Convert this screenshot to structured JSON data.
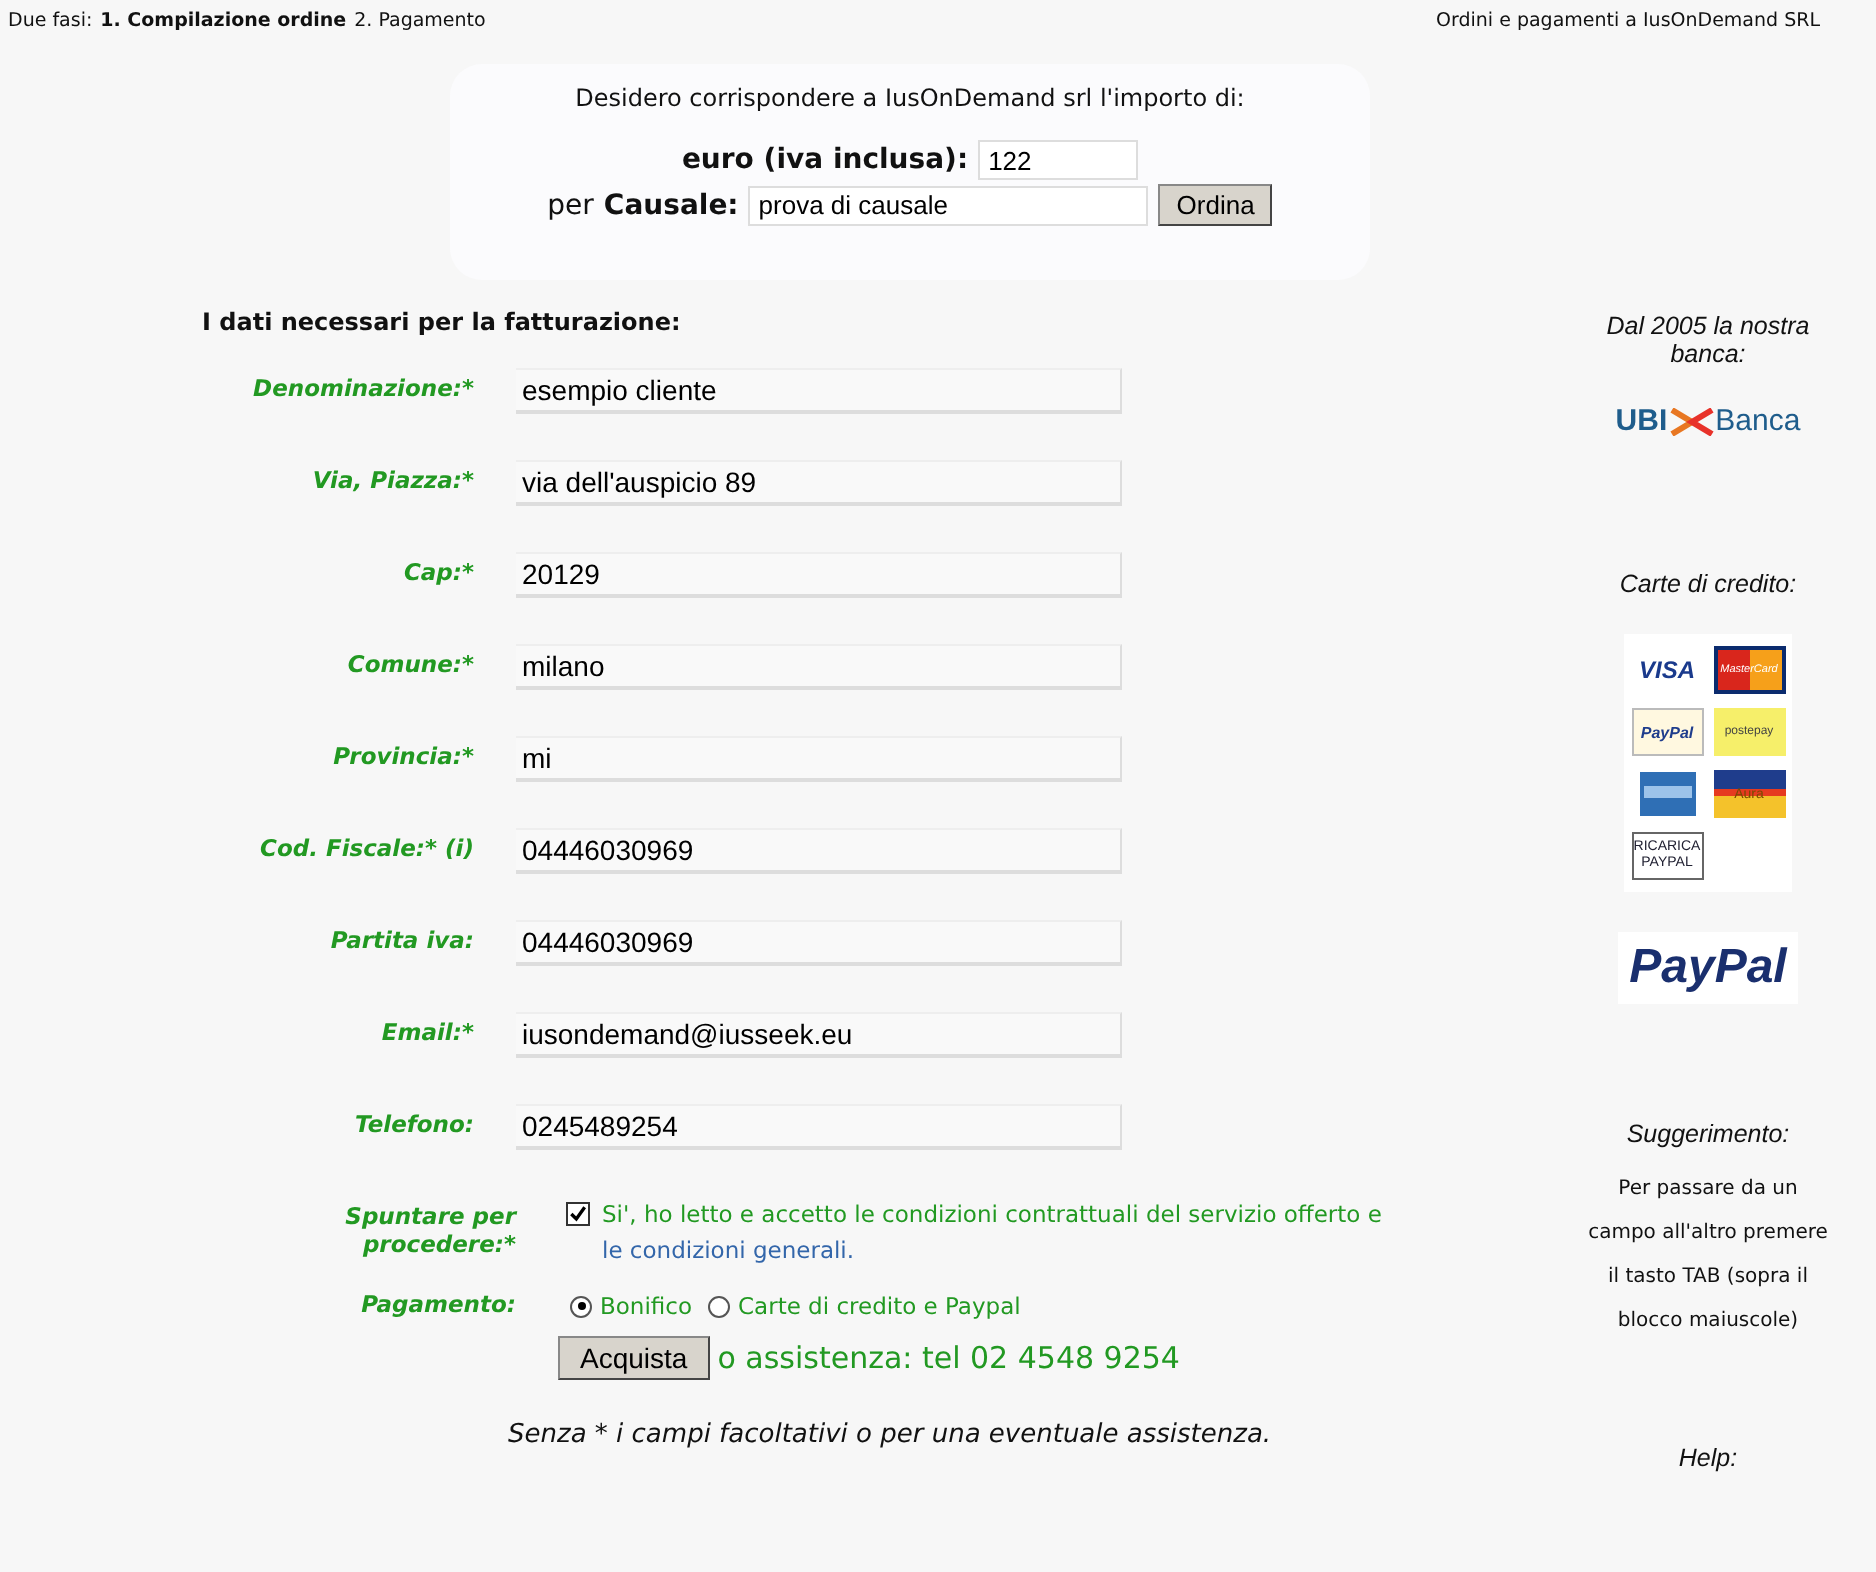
{
  "header": {
    "steps_label": "Due fasi:",
    "steps": [
      {
        "label": "1. Compilazione ordine",
        "selected": true
      },
      {
        "label": "2. Pagamento",
        "selected": false
      }
    ],
    "right": "Ordini e pagamenti a IusOnDemand SRL"
  },
  "order": {
    "intro": "Desidero corrispondere a IusOnDemand srl l'importo di:",
    "amount_label": "euro (iva inclusa):",
    "amount": "122",
    "reason_prefix": "per",
    "reason_label": "Causale:",
    "reason": "prova di causale",
    "button": "Ordina"
  },
  "billing": {
    "title": "I dati necessari per la fatturazione:",
    "fields": [
      {
        "label": "Denominazione:*",
        "value": "esempio cliente"
      },
      {
        "label": "Via, Piazza:*",
        "value": "via dell'auspicio 89"
      },
      {
        "label": "Cap:*",
        "value": "20129"
      },
      {
        "label": "Comune:*",
        "value": "milano"
      },
      {
        "label": "Provincia:*",
        "value": "mi"
      },
      {
        "label": "Cod. Fiscale:* (i)",
        "value": "04446030969"
      },
      {
        "label": "Partita iva:",
        "value": "04446030969"
      },
      {
        "label": "Email:*",
        "value": "iusondemand@iusseek.eu"
      },
      {
        "label": "Telefono:",
        "value": "0245489254"
      }
    ],
    "consent": {
      "label": "Spuntare per procedere:*",
      "checked": true,
      "text": "Si', ho letto e accetto le condizioni contrattuali del servizio offerto e",
      "link": "le condizioni generali."
    },
    "payment": {
      "label": "Pagamento:",
      "options": [
        {
          "label": "Bonifico",
          "selected": true
        },
        {
          "label": "Carte di credito e Paypal",
          "selected": false
        }
      ]
    },
    "button": "Acquista",
    "assistance": "o assistenza: tel 02 4548 9254",
    "note": "Senza * i campi facoltativi o per una eventuale assistenza."
  },
  "sidebar": {
    "bank_title": "Dal 2005 la nostra banca:",
    "bank_logo": [
      "UBI",
      "Banca"
    ],
    "cards_title": "Carte di credito:",
    "cards": [
      {
        "kind": "visa",
        "label": "VISA"
      },
      {
        "kind": "mastercard",
        "label": "MasterCard"
      },
      {
        "kind": "paypal",
        "label": "PayPal"
      },
      {
        "kind": "postepay",
        "label": "postepay"
      },
      {
        "kind": "amex"
      },
      {
        "kind": "aura",
        "label": "Aura"
      },
      {
        "kind": "ricarica",
        "label": "RICARICA PAYPAL"
      }
    ],
    "paypal_logo": "PayPal",
    "hint_title": "Suggerimento:",
    "hint": "Per passare da un campo all'altro premere il tasto TAB (sopra il blocco maiuscole)",
    "help_title": "Help:"
  }
}
